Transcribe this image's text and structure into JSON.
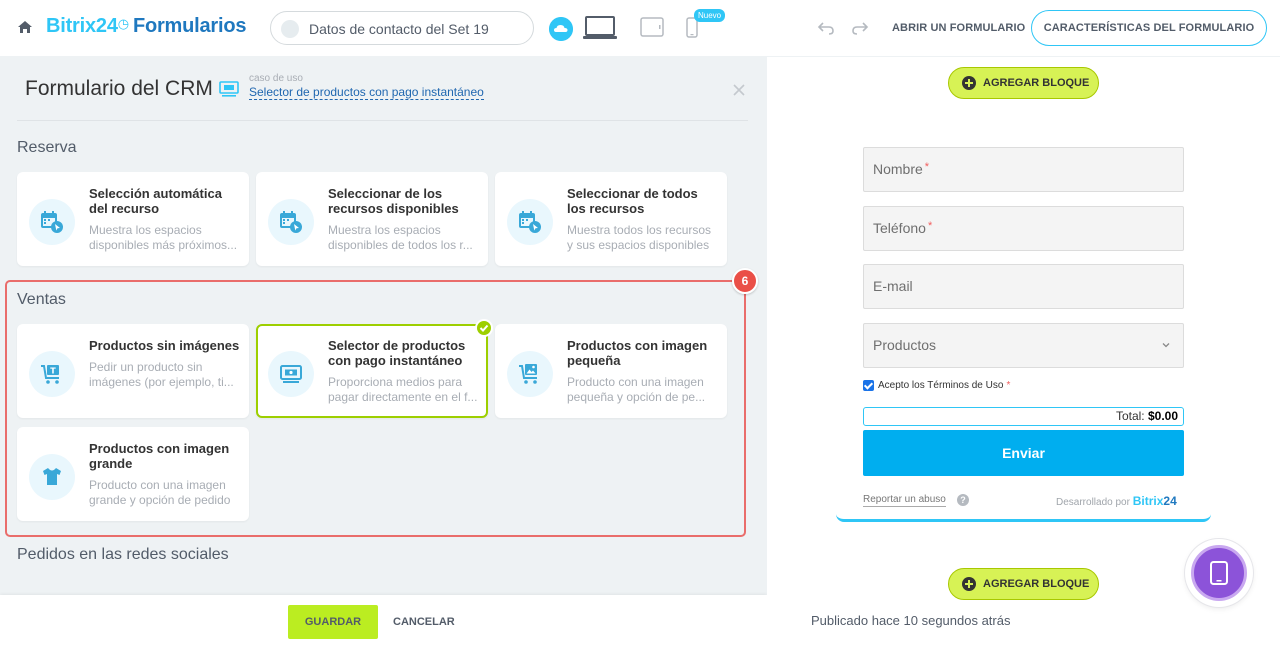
{
  "header": {
    "brand_b24": "Bitrix24",
    "brand_clock": "◷",
    "brand_forms": "Formularios",
    "form_selector_label": "Datos de contacto del Set 19",
    "new_badge": "Nuevo",
    "open_form": "ABRIR UN FORMULARIO",
    "features_button": "CARACTERÍSTICAS DEL FORMULARIO"
  },
  "panel": {
    "title": "Formulario del CRM",
    "usecase_caption": "caso de uso",
    "usecase_link": "Selector de productos con pago instantáneo"
  },
  "sections": {
    "reserva": "Reserva",
    "ventas": "Ventas",
    "social": "Pedidos en las redes sociales"
  },
  "highlight_number": "6",
  "cards": {
    "reserva": [
      {
        "title": "Selección automática del recurso",
        "desc1": "Muestra los espacios",
        "desc2": "disponibles más próximos...",
        "icon": "calendar-cursor-icon"
      },
      {
        "title": "Seleccionar de los recursos disponibles",
        "desc1": "Muestra los espacios",
        "desc2": "disponibles de todos los r...",
        "icon": "calendar-cursor-icon"
      },
      {
        "title": "Seleccionar de todos los recursos",
        "desc1": "Muestra todos los recursos",
        "desc2": "y sus espacios disponibles",
        "icon": "calendar-cursor-icon"
      }
    ],
    "ventas": [
      {
        "title": "Productos sin imágenes",
        "desc1": "Pedir un producto sin",
        "desc2": "imágenes (por ejemplo, ti...",
        "icon": "cart-icon"
      },
      {
        "title": "Selector de productos con pago instantáneo",
        "desc1": "Proporciona medios para",
        "desc2": "pagar directamente en el f...",
        "icon": "payment-screen-icon"
      },
      {
        "title": "Productos con imagen pequeña",
        "desc1": "Producto con una imagen",
        "desc2": "pequeña y opción de pe...",
        "icon": "cart-image-icon"
      },
      {
        "title": "Productos con imagen grande",
        "desc1": "Producto con una imagen",
        "desc2": "grande y opción de pedido",
        "icon": "tshirt-icon"
      }
    ]
  },
  "footer": {
    "save": "GUARDAR",
    "cancel": "CANCELAR"
  },
  "preview": {
    "add_block": "AGREGAR BLOQUE",
    "fields": [
      {
        "label": "Nombre",
        "required": "*"
      },
      {
        "label": "Teléfono",
        "required": "*"
      },
      {
        "label": "E-mail",
        "required": ""
      },
      {
        "label": "Productos",
        "required": ""
      }
    ],
    "terms": "Acepto los Términos de Uso",
    "terms_required": "*",
    "total_label": "Total:",
    "total_value": "$0.00",
    "send": "Enviar",
    "report": "Reportar un abuso",
    "help": "?",
    "powered_by": "Desarrollado por",
    "powered_brand": "Bitrix",
    "powered_brand_num": "24",
    "published": "Publicado hace 10 segundos atrás"
  },
  "colors": {
    "brand_blue": "#2fc6f6",
    "selected_green": "#9dcf00",
    "highlight_red": "#e96d6b",
    "send_blue": "#00aeef",
    "add_block_green": "#d7f255",
    "fab_purple": "#8c53d9"
  }
}
